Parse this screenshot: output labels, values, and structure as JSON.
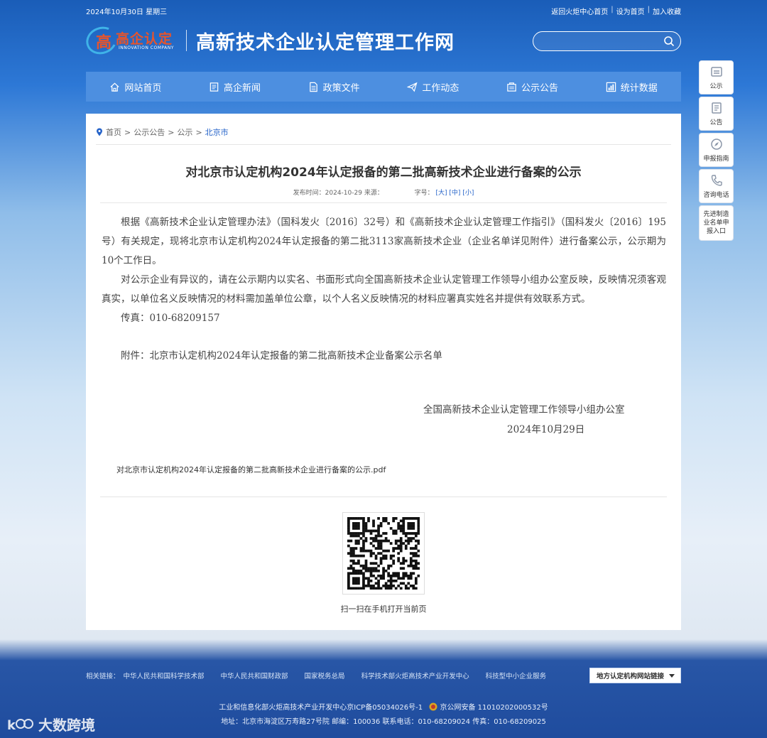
{
  "topbar": {
    "date": "2024年10月30日 星期三",
    "link_return": "返回火炬中心首页",
    "link_home": "设为首页",
    "link_fav": "加入收藏",
    "sep": "|"
  },
  "logo": {
    "cn": "高企认定",
    "en": "INNOVATION COMPANY",
    "mark": "高"
  },
  "site_name": "高新技术企业认定管理工作网",
  "search": {
    "placeholder": ""
  },
  "nav": [
    {
      "label": "网站首页",
      "icon": "home-icon"
    },
    {
      "label": "高企新闻",
      "icon": "news-icon"
    },
    {
      "label": "政策文件",
      "icon": "document-icon"
    },
    {
      "label": "工作动态",
      "icon": "paper-plane-icon"
    },
    {
      "label": "公示公告",
      "icon": "notice-icon"
    },
    {
      "label": "统计数据",
      "icon": "chart-icon"
    }
  ],
  "breadcrumb": {
    "home": "首页",
    "l1": "公示公告",
    "l2": "公示",
    "current": "北京市",
    "sep": ">"
  },
  "article": {
    "title": "对北京市认定机构2024年认定报备的第二批高新技术企业进行备案的公示",
    "publish_label": "发布时间：",
    "publish_date": "2024-10-29",
    "source_label": "来源：",
    "fontsize_label": "字号：",
    "fs_large": "[大]",
    "fs_medium": "[中]",
    "fs_small": "[小]",
    "p1": "根据《高新技术企业认定管理办法》（国科发火〔2016〕32号）和《高新技术企业认定管理工作指引》（国科发火〔2016〕195号）有关规定，现将北京市认定机构2024年认定报备的第二批3113家高新技术企业（企业名单详见附件）进行备案公示，公示期为10个工作日。",
    "p2": "对公示企业有异议的，请在公示期内以实名、书面形式向全国高新技术企业认定管理工作领导小组办公室反映，反映情况须客观真实，以单位名义反映情况的材料需加盖单位公章，以个人名义反映情况的材料应署真实姓名并提供有效联系方式。",
    "p3": "传真：010-68209157",
    "p4": "附件：北京市认定机构2024年认定报备的第二批高新技术企业备案公示名单",
    "signature": "全国高新技术企业认定管理工作领导小组办公室",
    "sign_date": "2024年10月29日",
    "attachment": "对北京市认定机构2024年认定报备的第二批高新技术企业进行备案的公示.pdf"
  },
  "qr_caption": "扫一扫在手机打开当前页",
  "sidebar": [
    {
      "label": "公示",
      "icon": "notice-board-icon"
    },
    {
      "label": "公告",
      "icon": "announcement-icon"
    },
    {
      "label": "申报指南",
      "icon": "compass-icon"
    },
    {
      "label": "咨询电话",
      "icon": "phone-icon"
    },
    {
      "label": "先进制造业名单申报入口",
      "icon": ""
    }
  ],
  "footer": {
    "links_label": "相关链接：",
    "links": [
      "中华人民共和国科学技术部",
      "中华人民共和国财政部",
      "国家税务总局",
      "科学技术部火炬高技术产业开发中心",
      "科技型中小企业服务"
    ],
    "select_label": "地方认定机构网站链接",
    "line1": "工业和信息化部火炬高技术产业开发中心京ICP备05034026号-1",
    "police": "京公网安备 11010202000532号",
    "line2": "地址：北京市海淀区万寿路27号院 邮编：100036 联系电话：010-68209024 传真：010-68209025"
  },
  "watermark": "大数跨境"
}
